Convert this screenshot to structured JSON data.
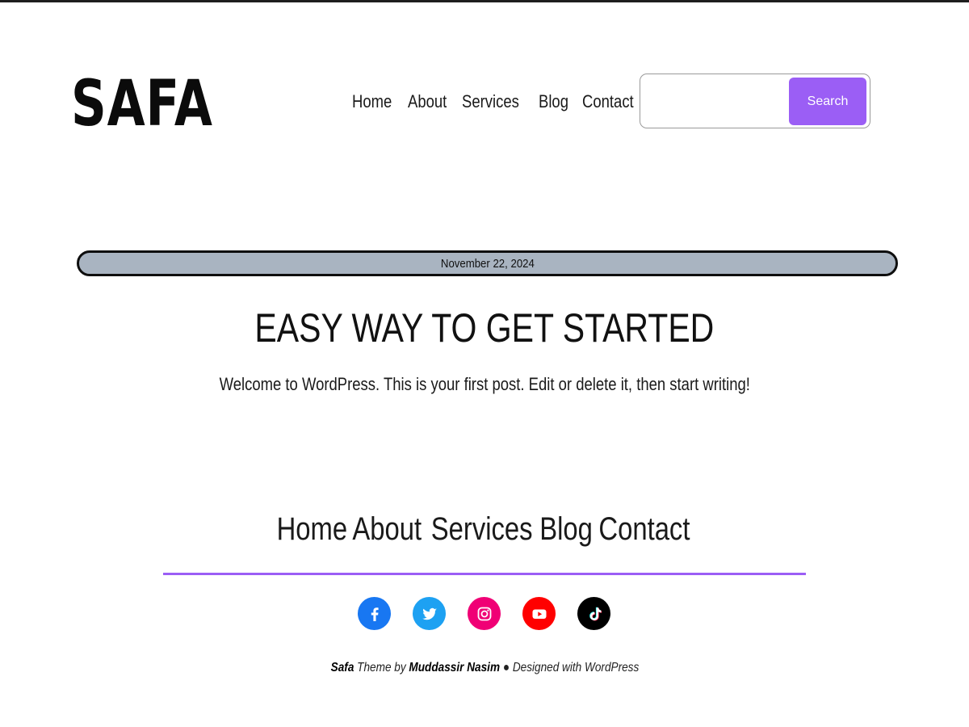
{
  "header": {
    "logo": "SAFA",
    "nav": [
      "Home",
      "About",
      "Services",
      "Blog",
      "Contact"
    ],
    "search": {
      "placeholder": "",
      "value": "",
      "button_label": "Search"
    }
  },
  "post": {
    "date": "November 22, 2024",
    "title": "EASY WAY TO GET STARTED",
    "body": "Welcome to WordPress. This is your first post. Edit or delete it, then start writing!"
  },
  "footer": {
    "nav": [
      "Home",
      "About",
      "Services",
      "Blog",
      "Contact"
    ],
    "socials": [
      {
        "name": "facebook-icon",
        "color": "#1877f2"
      },
      {
        "name": "twitter-icon",
        "color": "#1da1f2"
      },
      {
        "name": "instagram-icon",
        "color": "#f00075"
      },
      {
        "name": "youtube-icon",
        "color": "#ff0000"
      },
      {
        "name": "tiktok-icon",
        "color": "#000000"
      }
    ],
    "credit": {
      "theme_name": "Safa",
      "theme_by": " Theme by ",
      "author": "Muddassir Nasim",
      "separator": " ● ",
      "designed_with": "Designed with WordPress"
    }
  },
  "colors": {
    "accent": "#9b5ef5",
    "date_pill_bg": "#a9b4c1"
  }
}
